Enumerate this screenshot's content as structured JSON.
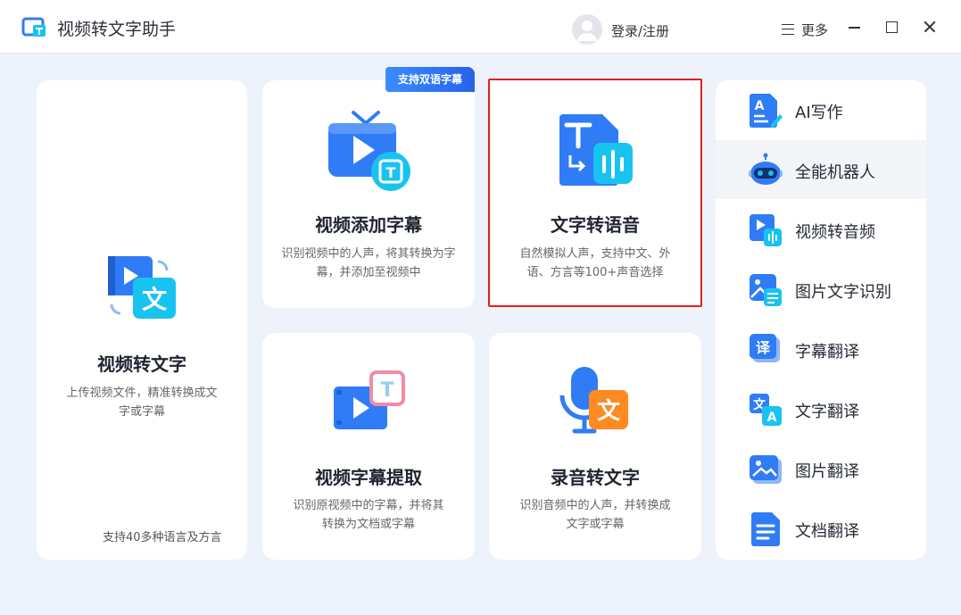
{
  "window": {
    "title": "视频转文字助手",
    "login_label": "登录/注册",
    "more_label": "更多"
  },
  "badge": {
    "text": "支持双语字幕"
  },
  "main_card": {
    "title": "视频转文字",
    "desc_line1": "上传视频文件，精准转换成文",
    "desc_line2": "字或字幕",
    "footnote": "支持40多种语言及方言"
  },
  "cards": [
    {
      "title": "视频添加字幕",
      "desc_line1": "识别视频中的人声，将其转换为字",
      "desc_line2": "幕，并添加至视频中"
    },
    {
      "title": "文字转语音",
      "desc_line1": "自然模拟人声，支持中文、外",
      "desc_line2": "语、方言等100+声音选择"
    },
    {
      "title": "视频字幕提取",
      "desc_line1": "识别原视频中的字幕，并将其",
      "desc_line2": "转换为文档或字幕"
    },
    {
      "title": "录音转文字",
      "desc_line1": "识别音频中的人声，并转换成",
      "desc_line2": "文字或字幕"
    }
  ],
  "sidebar": {
    "items": [
      {
        "label": "AI写作",
        "icon": "ai-writing-icon"
      },
      {
        "label": "全能机器人",
        "icon": "robot-icon"
      },
      {
        "label": "视频转音频",
        "icon": "video-to-audio-icon"
      },
      {
        "label": "图片文字识别",
        "icon": "image-ocr-icon"
      },
      {
        "label": "字幕翻译",
        "icon": "subtitle-translate-icon"
      },
      {
        "label": "文字翻译",
        "icon": "text-translate-icon"
      },
      {
        "label": "图片翻译",
        "icon": "image-translate-icon"
      },
      {
        "label": "文档翻译",
        "icon": "document-translate-icon"
      }
    ],
    "active_index": 1
  },
  "icon_text": {
    "wen": "文",
    "t": "T",
    "yi": "译",
    "a": "A"
  },
  "colors": {
    "accent": "#2f7cf6",
    "cyan": "#19c3f0",
    "orange": "#ff8a1f",
    "selection_border": "#e02020"
  }
}
